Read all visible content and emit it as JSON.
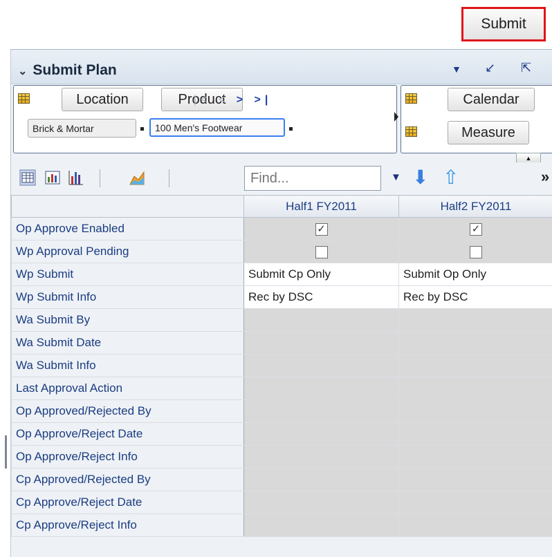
{
  "submit_button": {
    "label": "Submit"
  },
  "panel": {
    "title": "Submit Plan",
    "location_button": "Location",
    "product_button": "Product",
    "calendar_button": "Calendar",
    "measure_button": "Measure",
    "chips": [
      "Brick & Mortar",
      "100 Men's Footwear"
    ]
  },
  "toolbar": {
    "find_placeholder": "Find..."
  },
  "table": {
    "columns": [
      "Half1 FY2011",
      "Half2 FY2011"
    ],
    "rows": [
      {
        "label": "Op Approve Enabled",
        "type": "checkbox",
        "values": [
          "✓",
          "✓"
        ]
      },
      {
        "label": "Wp Approval Pending",
        "type": "checkbox",
        "values": [
          "",
          ""
        ]
      },
      {
        "label": "Wp Submit",
        "type": "text",
        "values": [
          "Submit Cp Only",
          "Submit Op Only"
        ]
      },
      {
        "label": "Wp Submit Info",
        "type": "text",
        "values": [
          "Rec by DSC",
          "Rec by DSC"
        ]
      },
      {
        "label": "Wa Submit By",
        "type": "empty",
        "values": [
          "",
          ""
        ]
      },
      {
        "label": "Wa Submit Date",
        "type": "empty",
        "values": [
          "",
          ""
        ]
      },
      {
        "label": "Wa Submit Info",
        "type": "empty",
        "values": [
          "",
          ""
        ]
      },
      {
        "label": "Last Approval Action",
        "type": "empty",
        "values": [
          "",
          ""
        ]
      },
      {
        "label": "Op Approved/Rejected By",
        "type": "empty",
        "values": [
          "",
          ""
        ]
      },
      {
        "label": "Op Approve/Reject Date",
        "type": "empty",
        "values": [
          "",
          ""
        ]
      },
      {
        "label": "Op Approve/Reject Info",
        "type": "empty",
        "values": [
          "",
          ""
        ]
      },
      {
        "label": "Cp Approved/Rejected By",
        "type": "empty",
        "values": [
          "",
          ""
        ]
      },
      {
        "label": "Cp Approve/Reject Date",
        "type": "empty",
        "values": [
          "",
          ""
        ]
      },
      {
        "label": "Cp Approve/Reject Info",
        "type": "empty",
        "values": [
          "",
          ""
        ]
      }
    ]
  },
  "colors": {
    "accent_red": "#e0141b",
    "header_text": "#1b3e84",
    "selected_chip": "#3a7ff0"
  }
}
